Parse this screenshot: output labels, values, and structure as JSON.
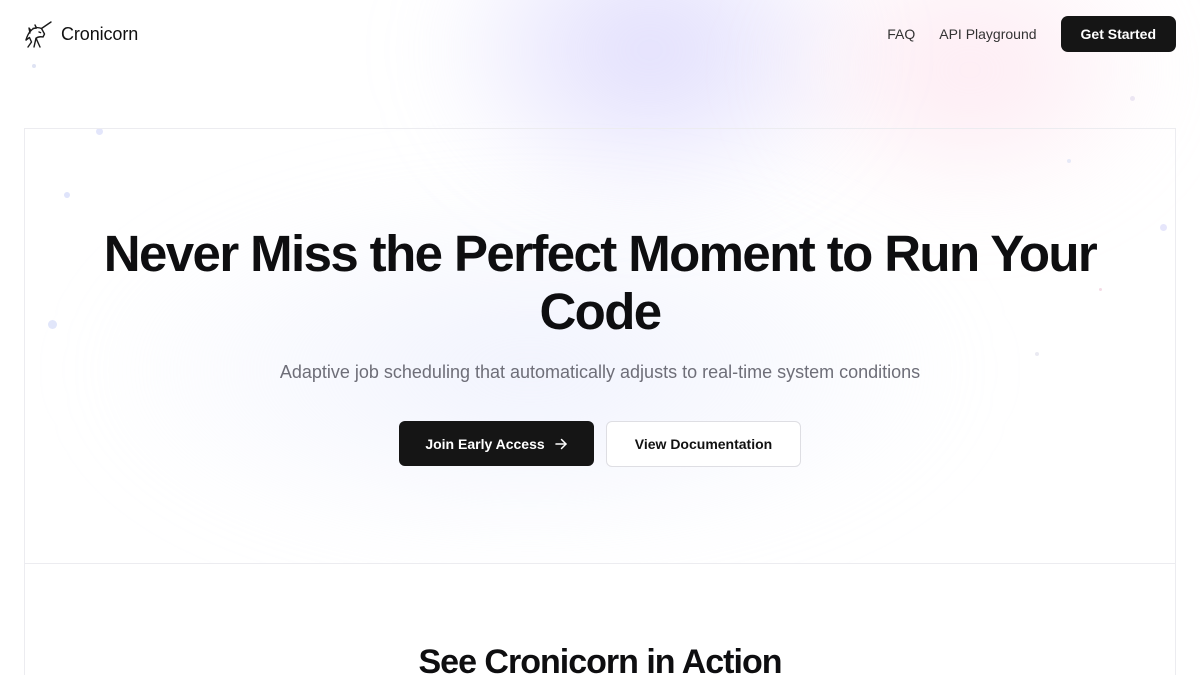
{
  "header": {
    "brand_name": "Cronicorn",
    "logo_icon": "unicorn-icon",
    "nav": [
      {
        "label": "FAQ"
      },
      {
        "label": "API Playground"
      }
    ],
    "cta_label": "Get Started"
  },
  "hero": {
    "title": "Never Miss the Perfect Moment to Run Your Code",
    "subtitle": "Adaptive job scheduling that automatically adjusts to real-time system conditions",
    "primary_button": {
      "label": "Join Early Access",
      "icon": "arrow-right-icon"
    },
    "secondary_button": {
      "label": "View Documentation"
    }
  },
  "demo_section": {
    "title": "See Cronicorn in Action"
  },
  "colors": {
    "primary_button_bg": "#151515",
    "glow_purple": "#c4befa",
    "glow_pink": "#fcd6e6",
    "border": "#ececf0",
    "subtitle_text": "#6e6e78"
  }
}
